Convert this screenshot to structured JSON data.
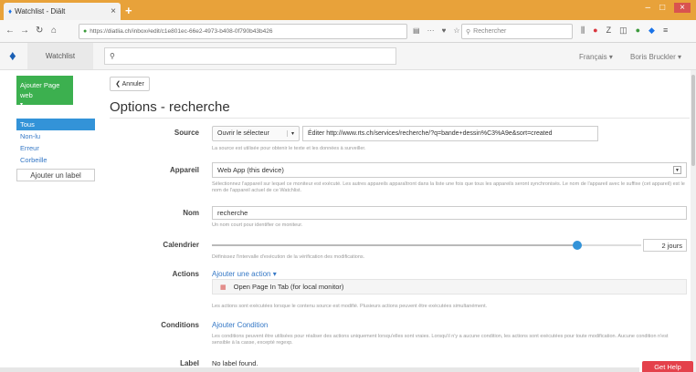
{
  "browser": {
    "tab_title": "Watchlist - Diält",
    "url": "https://diatlia.ch/inbox#edit/c1e801ec-66e2-4973-b408-0f790b43b426",
    "search_placeholder": "Rechercher"
  },
  "app": {
    "name": "Watchlist",
    "language": "Français ▾",
    "user": "Boris Bruckler ▾"
  },
  "sidebar": {
    "add_page_label": "Ajouter Page web",
    "add_page_caret": "▾",
    "items": [
      {
        "label": "Tous",
        "active": true
      },
      {
        "label": "Non-lu",
        "active": false
      },
      {
        "label": "Erreur",
        "active": false
      },
      {
        "label": "Corbeille",
        "active": false
      }
    ],
    "add_label_button": "Ajouter un label"
  },
  "main": {
    "back_button": "❮ Annuler",
    "title": "Options - recherche",
    "source": {
      "label": "Source",
      "picker_button": "Ouvrir le sélecteur",
      "url_value": "Éditer http://www.rts.ch/services/recherche/?q=bande+dessin%C3%A9e&sort=created",
      "help": "La source est utilisée pour obtenir le texte et les données à surveiller."
    },
    "device": {
      "label": "Appareil",
      "value": "Web App (this device)",
      "help": "Sélectionnez l'appareil sur lequel ce moniteur est exécuté. Les autres appareils apparaîtront dans la liste une fois que tous les appareils seront synchronisés. Le nom de l'appareil avec le suffixe (cet appareil) est le nom de l'appareil actuel de ce Watchlist."
    },
    "name": {
      "label": "Nom",
      "value": "recherche",
      "help": "Un nom court pour identifier ce moniteur."
    },
    "schedule": {
      "label": "Calendrier",
      "value": "2 jours",
      "level": 0.85,
      "help": "Définissez l'intervalle d'exécution de la vérification des modifications."
    },
    "actions": {
      "label": "Actions",
      "add_link": "Ajouter une action ▾",
      "item": "Open Page In Tab (for local monitor)",
      "help": "Les actions sont exécutées lorsque le contenu source est modifié. Plusieurs actions peuvent être exécutées simultanément."
    },
    "conditions": {
      "label": "Conditions",
      "add_link": "Ajouter Condition",
      "help": "Les conditions peuvent être utilisées pour réaliser des actions uniquement lorsqu'elles sont vraies. Lorsqu'il n'y a aucune condition, les actions sont exécutées pour toute modification. Aucune condition n'est sensible à la casse, excepté regexp."
    },
    "label_field": {
      "label": "Label",
      "value": "No label found."
    }
  },
  "get_help": "Get Help",
  "colors": {
    "tabbar": "#e8a23a",
    "accent": "#3393d8",
    "add_button": "#3cb04f",
    "help_button": "#e4414b"
  }
}
